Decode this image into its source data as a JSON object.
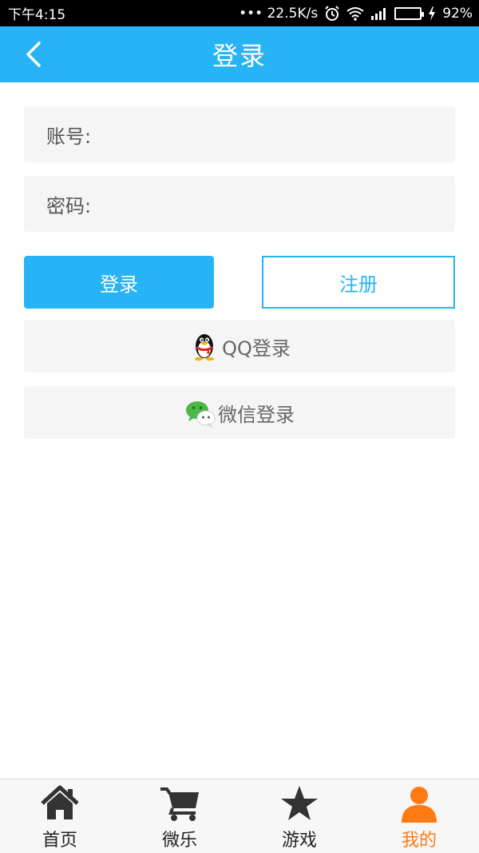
{
  "status_bar": {
    "time": "下午4:15",
    "network_speed": "••• 22.5K/s",
    "battery": "92%",
    "icons": [
      "alarm-icon",
      "wifi-icon",
      "signal-icon",
      "battery-icon",
      "charging-icon"
    ]
  },
  "header": {
    "title": "登录",
    "back_icon": "chevron-left-icon"
  },
  "form": {
    "account_label": "账号:",
    "account_value": "",
    "password_label": "密码:",
    "password_value": ""
  },
  "buttons": {
    "login": "登录",
    "register": "注册",
    "qq_login": "QQ登录",
    "wechat_login": "微信登录"
  },
  "tabbar": {
    "items": [
      {
        "label": "首页",
        "icon": "home-icon"
      },
      {
        "label": "微乐",
        "icon": "cart-icon"
      },
      {
        "label": "游戏",
        "icon": "star-icon"
      },
      {
        "label": "我的",
        "icon": "user-icon"
      }
    ],
    "active_index": 3
  },
  "colors": {
    "primary": "#28b3f6",
    "active_tab": "#ff7a10",
    "field_bg": "#f5f5f5"
  }
}
